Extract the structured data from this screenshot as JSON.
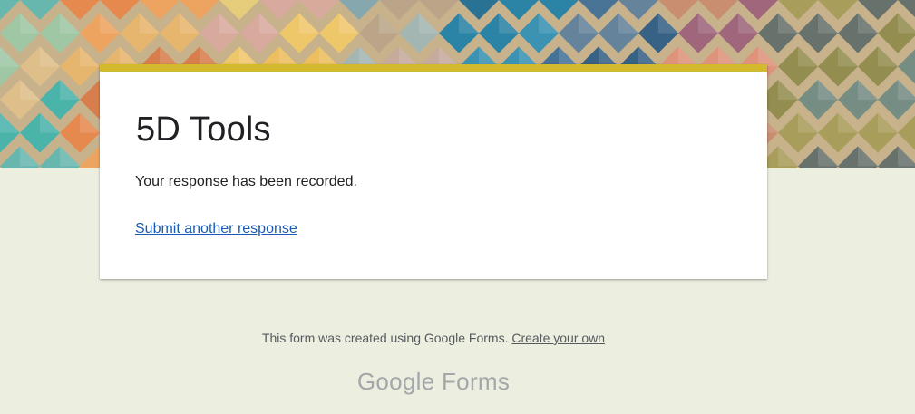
{
  "header": {
    "banner_colors": [
      "#e8864a",
      "#efbf5a",
      "#5fb7b2",
      "#1d7fa8",
      "#3f6f97",
      "#9b5f7b",
      "#d6614e",
      "#8e8a4a",
      "#e7cf78",
      "#c9b9a4"
    ]
  },
  "card": {
    "accent_color": "#d2b92e",
    "title": "5D Tools",
    "confirmation_message": "Your response has been recorded.",
    "submit_another_label": "Submit another response"
  },
  "footer": {
    "note": "This form was created using Google Forms.",
    "create_link_label": "Create your own",
    "brand_google": "Google",
    "brand_forms": "Forms"
  }
}
